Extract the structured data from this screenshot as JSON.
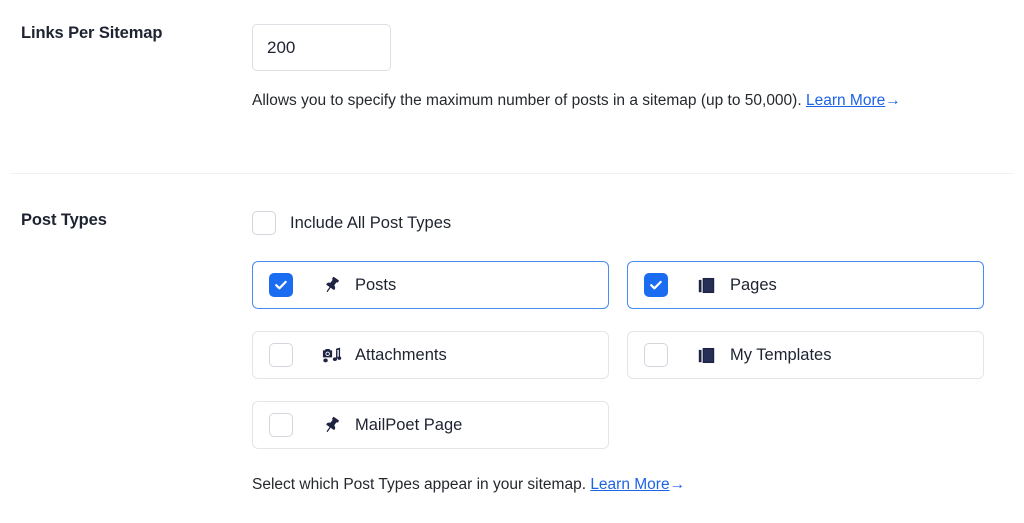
{
  "colors": {
    "accent_blue": "#1a6cf0",
    "card_border_active": "#4a8bf0",
    "card_border_inactive": "#e3e5e9",
    "link_blue": "#1d63e6",
    "text_dark": "#1e2331",
    "divider": "#f0f1f3",
    "icon_navy": "#1d2340"
  },
  "links_per_sitemap": {
    "label": "Links Per Sitemap",
    "input_value": "200",
    "input_placeholder": "200",
    "help_text": "Allows you to specify the maximum number of posts in a sitemap (up to 50,000).",
    "help_link_label": "Learn More",
    "help_link_arrow": "→"
  },
  "post_types": {
    "label": "Post Types",
    "include_all": {
      "label": "Include All Post Types",
      "checked": false,
      "icon": "checkbox-icon"
    },
    "items": [
      {
        "label": "Posts",
        "checked": true,
        "icon": "pushpin-icon"
      },
      {
        "label": "Pages",
        "checked": true,
        "icon": "pages-icon"
      },
      {
        "label": "Attachments",
        "checked": false,
        "icon": "media-icon"
      },
      {
        "label": "My Templates",
        "checked": false,
        "icon": "pages-icon"
      },
      {
        "label": "MailPoet Page",
        "checked": false,
        "icon": "pushpin-icon"
      }
    ],
    "help_text": "Select which Post Types appear in your sitemap.",
    "help_link_label": "Learn More",
    "help_link_arrow": "→"
  }
}
